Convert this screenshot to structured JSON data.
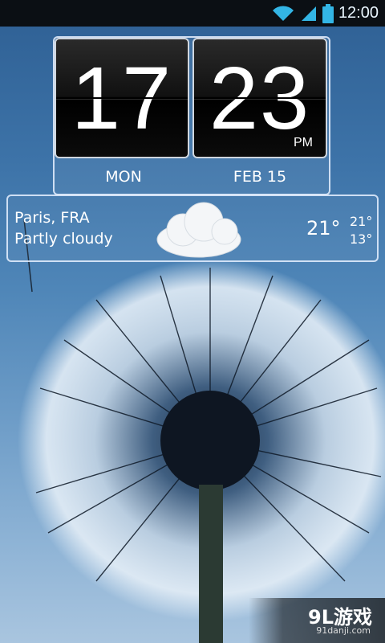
{
  "status_bar": {
    "time": "12:00"
  },
  "clock": {
    "hours": "17",
    "minutes": "23",
    "ampm": "PM",
    "day": "MON",
    "date": "FEB 15"
  },
  "weather": {
    "city": "Paris, FRA",
    "condition": "Partly cloudy",
    "current_temp": "21°",
    "high_temp": "21°",
    "low_temp": "13°",
    "icon": "cloud-icon"
  },
  "watermark": {
    "brand": "9L游戏",
    "site": "91danji.com"
  },
  "colors": {
    "status_bar_bg": "#0b0f14",
    "status_accent": "#33b5e5",
    "sky": "#3d73a8"
  }
}
